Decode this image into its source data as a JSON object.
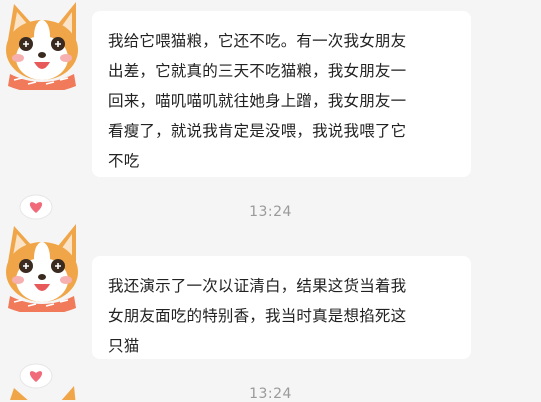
{
  "messages": [
    {
      "lines": [
        "我给它喂猫粮，它还不吃。有一次我女朋友",
        "出差，它就真的三天不吃猫粮，我女朋友一",
        "回来，喵叽喵叽就往她身上蹭，我女朋友一",
        "看瘦了，就说我肯定是没喂，我说我喂了它",
        "不吃"
      ],
      "avatar_icon": "shiba-dog-avatar-icon"
    },
    {
      "lines": [
        "我还演示了一次以证清白，结果这货当着我",
        "女朋友面吃的特别香，我当时真是想掐死这",
        "只猫"
      ],
      "avatar_icon": "shiba-dog-avatar-icon"
    }
  ],
  "timestamps": [
    "13:24",
    "13:24"
  ],
  "colors": {
    "background": "#f5f5f5",
    "bubble": "#ffffff",
    "text": "#222222",
    "timestamp": "#9a9a9a",
    "dog_orange": "#f0a648",
    "scarf": "#f07a5a",
    "heart": "#f06a7a"
  }
}
